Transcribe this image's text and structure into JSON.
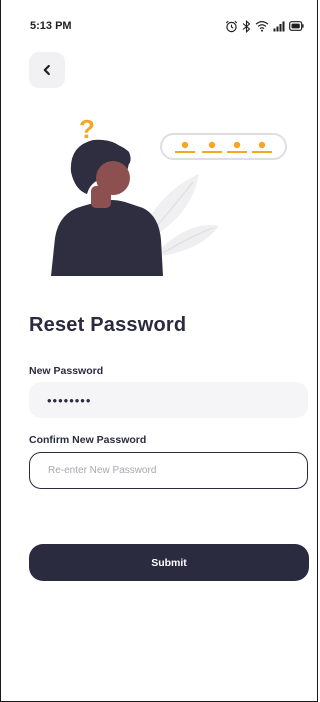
{
  "status_bar": {
    "time": "5:13 PM",
    "icons": [
      "alarm-icon",
      "bluetooth-icon",
      "wifi-icon",
      "signal-icon",
      "battery-icon"
    ]
  },
  "header": {
    "back_icon": "chevron-left-icon"
  },
  "page": {
    "title": "Reset Password"
  },
  "form": {
    "new_password_label": "New Password",
    "new_password_value": "••••••••",
    "confirm_password_label": "Confirm New Password",
    "confirm_password_value": "",
    "confirm_password_placeholder": "Re-enter New Password",
    "submit_label": "Submit"
  },
  "colors": {
    "primary": "#2a2b3e",
    "accent": "#f5a623",
    "input_bg": "#f5f5f7",
    "skin": "#8d5050"
  }
}
